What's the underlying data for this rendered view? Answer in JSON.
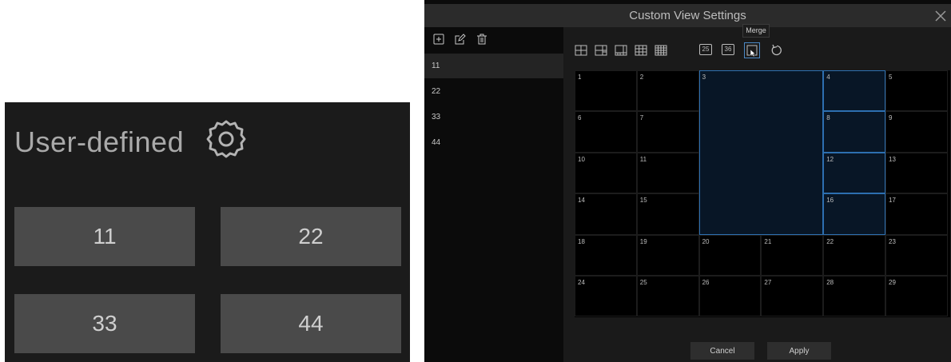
{
  "user_defined": {
    "title": "User-defined",
    "buttons": [
      "11",
      "22",
      "33",
      "44"
    ]
  },
  "dialog": {
    "title": "Custom View Settings",
    "tooltip": "Merge",
    "views": [
      "11",
      "22",
      "33",
      "44"
    ],
    "layout_labels": [
      "25",
      "36"
    ],
    "cancel_label": "Cancel",
    "apply_label": "Apply",
    "accent_color": "#2d6fb0"
  },
  "grid": {
    "cells": [
      "1",
      "2",
      "3",
      "4",
      "5",
      "6",
      "7",
      "8",
      "9",
      "10",
      "11",
      "12",
      "13",
      "14",
      "15",
      "16",
      "17",
      "18",
      "19",
      "20",
      "21",
      "22",
      "23",
      "24",
      "25",
      "26",
      "27",
      "28",
      "29"
    ]
  }
}
